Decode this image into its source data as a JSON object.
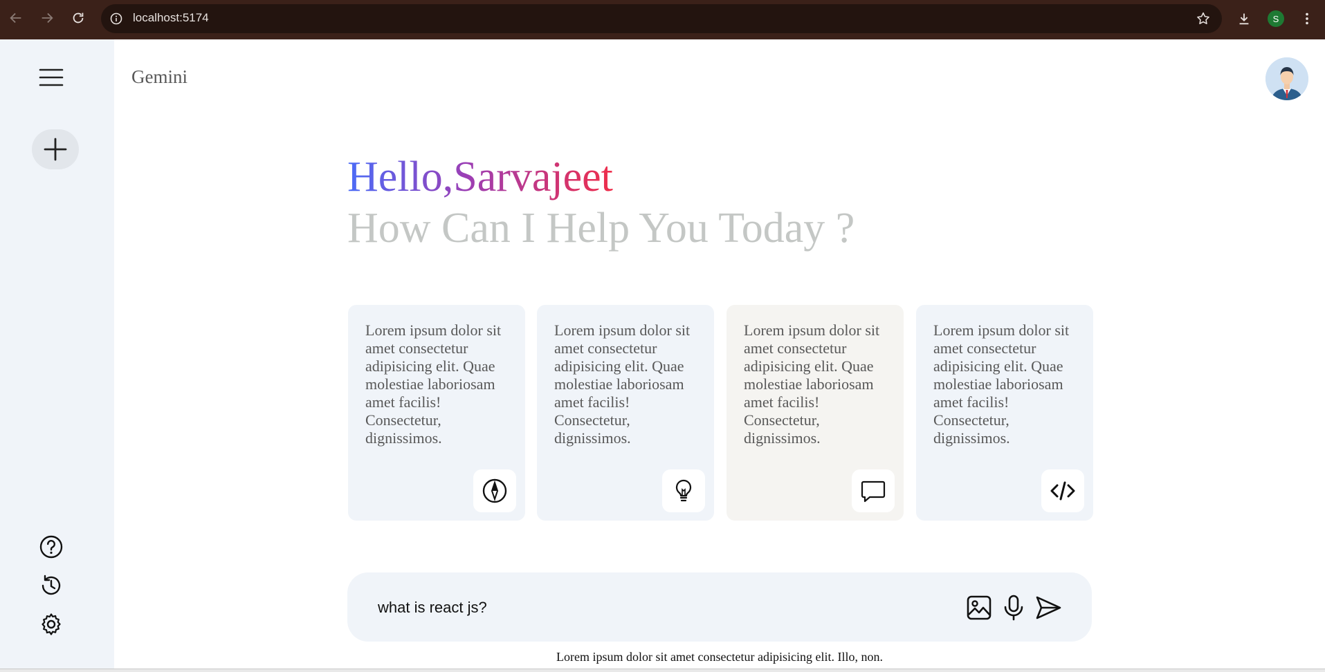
{
  "browser": {
    "url": "localhost:5174",
    "profile_initial": "S"
  },
  "app": {
    "brand": "Gemini"
  },
  "greeting": {
    "hello": "Hello,Sarvajeet",
    "subtitle": "How Can I Help You Today ?"
  },
  "cards": [
    {
      "text": "Lorem ipsum dolor sit amet consectetur adipisicing elit. Quae molestiae laboriosam amet facilis! Consectetur, dignissimos.",
      "icon": "compass-icon"
    },
    {
      "text": "Lorem ipsum dolor sit amet consectetur adipisicing elit. Quae molestiae laboriosam amet facilis! Consectetur, dignissimos.",
      "icon": "bulb-icon"
    },
    {
      "text": "Lorem ipsum dolor sit amet consectetur adipisicing elit. Quae molestiae laboriosam amet facilis! Consectetur, dignissimos.",
      "icon": "message-icon"
    },
    {
      "text": "Lorem ipsum dolor sit amet consectetur adipisicing elit. Quae molestiae laboriosam amet facilis! Consectetur, dignissimos.",
      "icon": "code-icon"
    }
  ],
  "prompt": {
    "value": "what is react js?"
  },
  "footer": {
    "note": "Lorem ipsum dolor sit amet consectetur adipisicing elit. Illo, non."
  },
  "sidebar": {
    "bottom_icons": [
      "help-icon",
      "history-icon",
      "settings-icon"
    ]
  }
}
